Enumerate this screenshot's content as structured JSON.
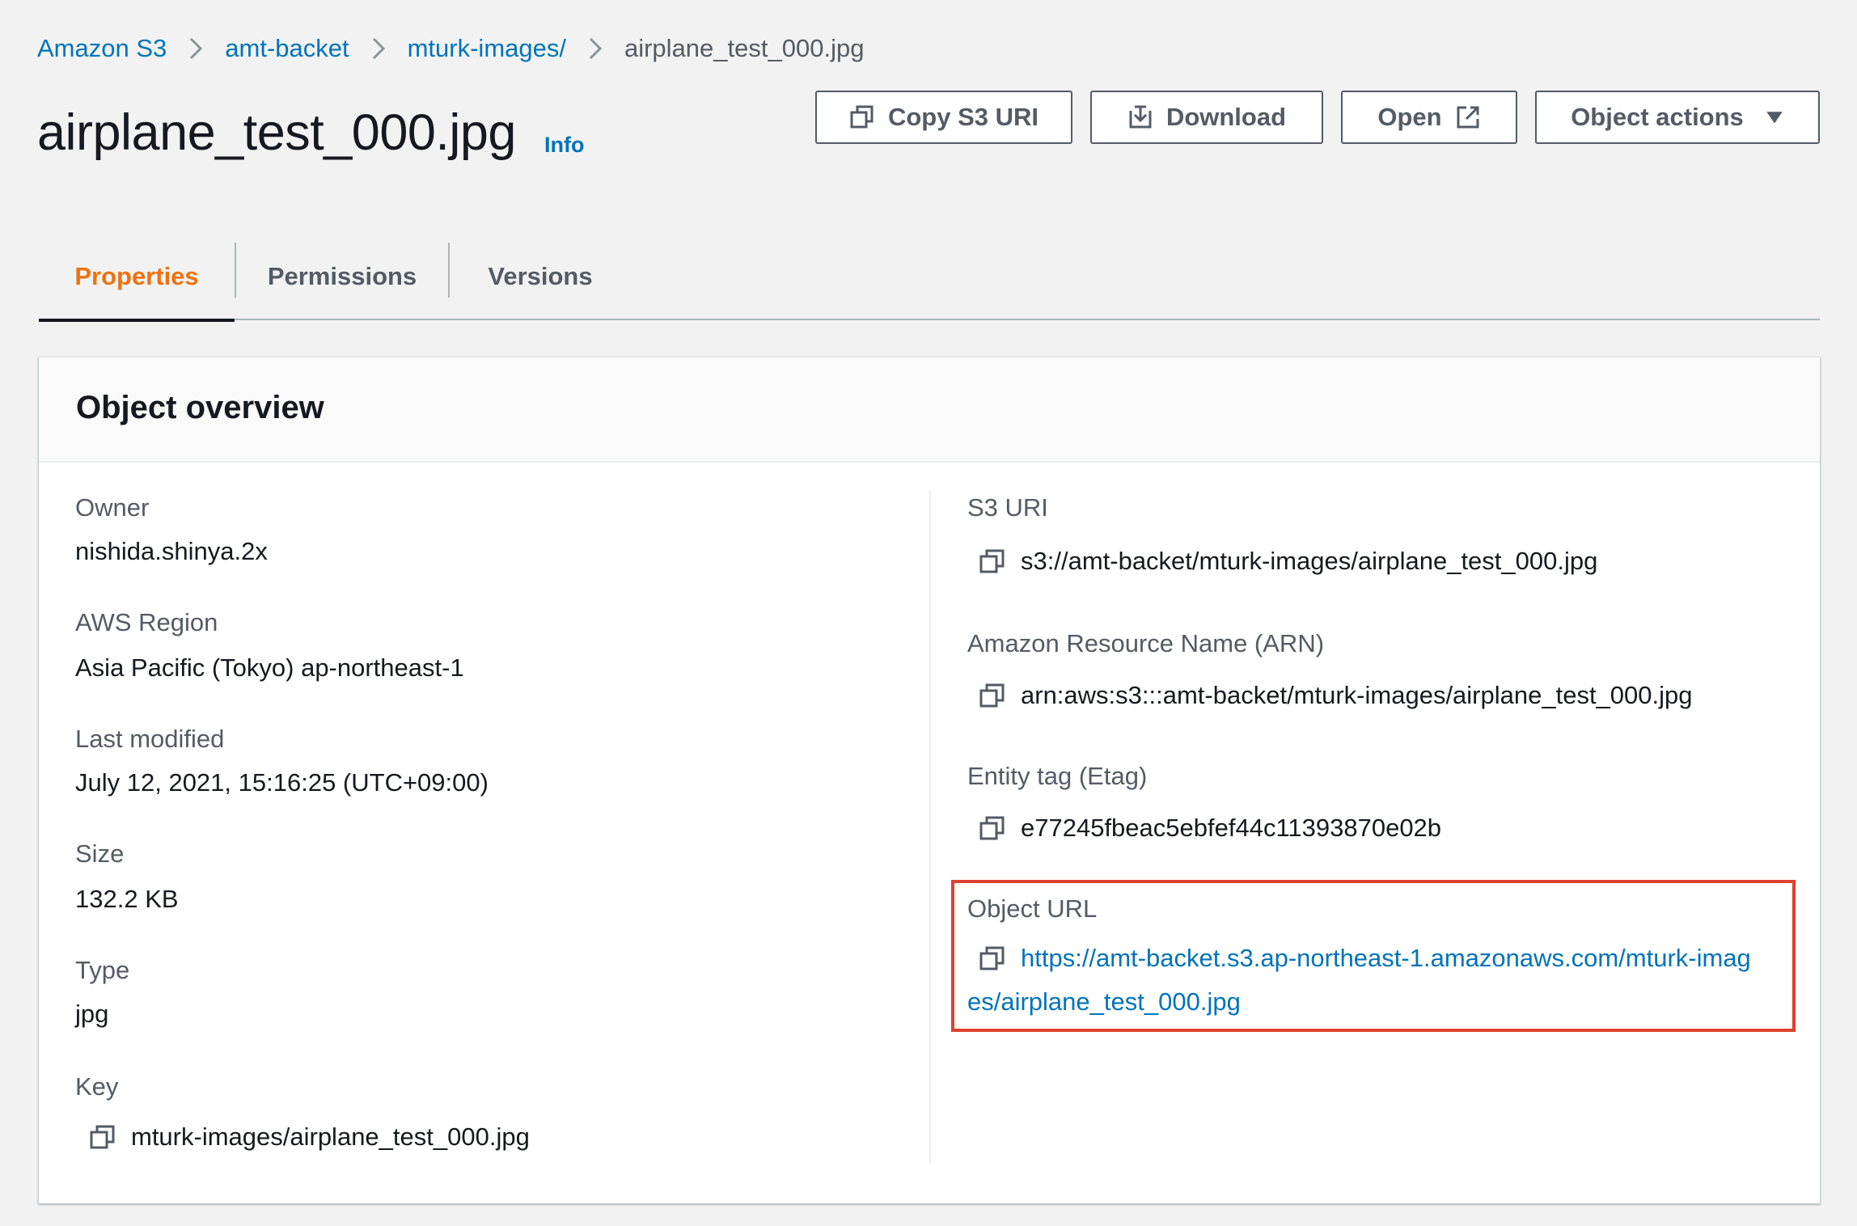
{
  "breadcrumb": {
    "items": [
      "Amazon S3",
      "amt-backet",
      "mturk-images/"
    ],
    "current": "airplane_test_000.jpg"
  },
  "page": {
    "title": "airplane_test_000.jpg",
    "info_label": "Info"
  },
  "toolbar": {
    "copy_uri_label": "Copy S3 URI",
    "download_label": "Download",
    "open_label": "Open",
    "object_actions_label": "Object actions"
  },
  "tabs": [
    {
      "label": "Properties",
      "active": true
    },
    {
      "label": "Permissions",
      "active": false
    },
    {
      "label": "Versions",
      "active": false
    }
  ],
  "overview": {
    "title": "Object overview",
    "owner": {
      "label": "Owner",
      "value": "nishida.shinya.2x"
    },
    "region": {
      "label": "AWS Region",
      "value": "Asia Pacific (Tokyo) ap-northeast-1"
    },
    "last_modified": {
      "label": "Last modified",
      "value": "July 12, 2021, 15:16:25 (UTC+09:00)"
    },
    "size": {
      "label": "Size",
      "value": "132.2 KB"
    },
    "type": {
      "label": "Type",
      "value": "jpg"
    },
    "key": {
      "label": "Key",
      "value": "mturk-images/airplane_test_000.jpg"
    },
    "s3_uri": {
      "label": "S3 URI",
      "value": "s3://amt-backet/mturk-images/airplane_test_000.jpg"
    },
    "arn": {
      "label": "Amazon Resource Name (ARN)",
      "value": "arn:aws:s3:::amt-backet/mturk-images/airplane_test_000.jpg"
    },
    "etag": {
      "label": "Entity tag (Etag)",
      "value": "e77245fbeac5ebfef44c11393870e02b"
    },
    "object_url": {
      "label": "Object URL",
      "value_line1": "https://amt-backet.s3.ap-northeast-1.amazonaws.com/mturk-imag",
      "value_line2": "es/airplane_test_000.jpg"
    }
  },
  "colors": {
    "link": "#0073bb",
    "active_tab": "#ec7211",
    "highlight": "#e0412f",
    "background": "#f2f2f2"
  }
}
